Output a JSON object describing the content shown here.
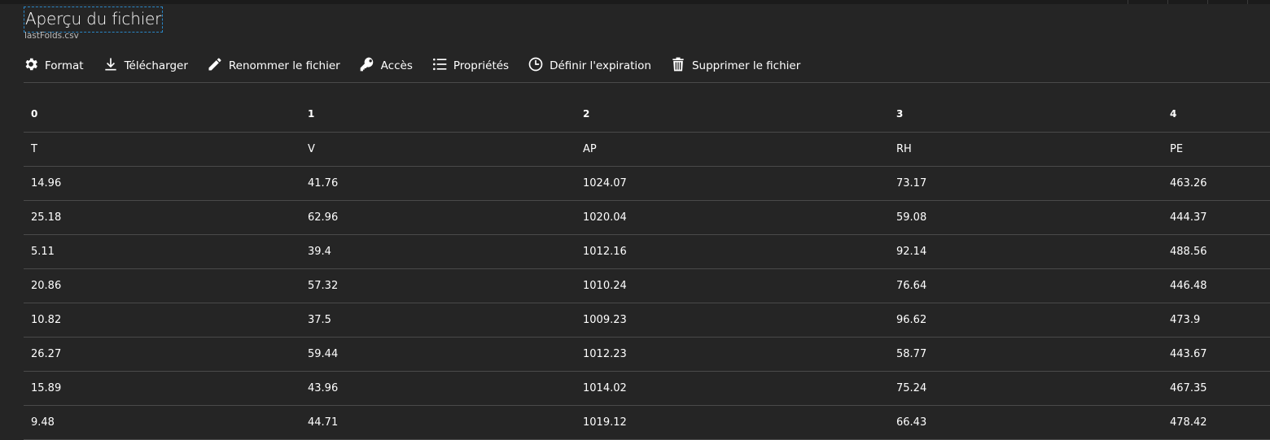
{
  "header": {
    "title": "Aperçu du fichier",
    "subtitle": "lastFolds.csv"
  },
  "toolbar": {
    "items": [
      {
        "label": "Format",
        "icon": "gear-icon"
      },
      {
        "label": "Télécharger",
        "icon": "download-icon"
      },
      {
        "label": "Renommer le fichier",
        "icon": "pencil-icon"
      },
      {
        "label": "Accès",
        "icon": "key-icon"
      },
      {
        "label": "Propriétés",
        "icon": "list-icon"
      },
      {
        "label": "Définir l'expiration",
        "icon": "clock-icon"
      },
      {
        "label": "Supprimer le fichier",
        "icon": "trash-icon"
      }
    ]
  },
  "table": {
    "headers": [
      "0",
      "1",
      "2",
      "3",
      "4"
    ],
    "rows": [
      [
        "T",
        "V",
        "AP",
        "RH",
        "PE"
      ],
      [
        "14.96",
        "41.76",
        "1024.07",
        "73.17",
        "463.26"
      ],
      [
        "25.18",
        "62.96",
        "1020.04",
        "59.08",
        "444.37"
      ],
      [
        "5.11",
        "39.4",
        "1012.16",
        "92.14",
        "488.56"
      ],
      [
        "20.86",
        "57.32",
        "1010.24",
        "76.64",
        "446.48"
      ],
      [
        "10.82",
        "37.5",
        "1009.23",
        "96.62",
        "473.9"
      ],
      [
        "26.27",
        "59.44",
        "1012.23",
        "58.77",
        "443.67"
      ],
      [
        "15.89",
        "43.96",
        "1014.02",
        "75.24",
        "467.35"
      ],
      [
        "9.48",
        "44.71",
        "1019.12",
        "66.43",
        "478.42"
      ]
    ]
  }
}
